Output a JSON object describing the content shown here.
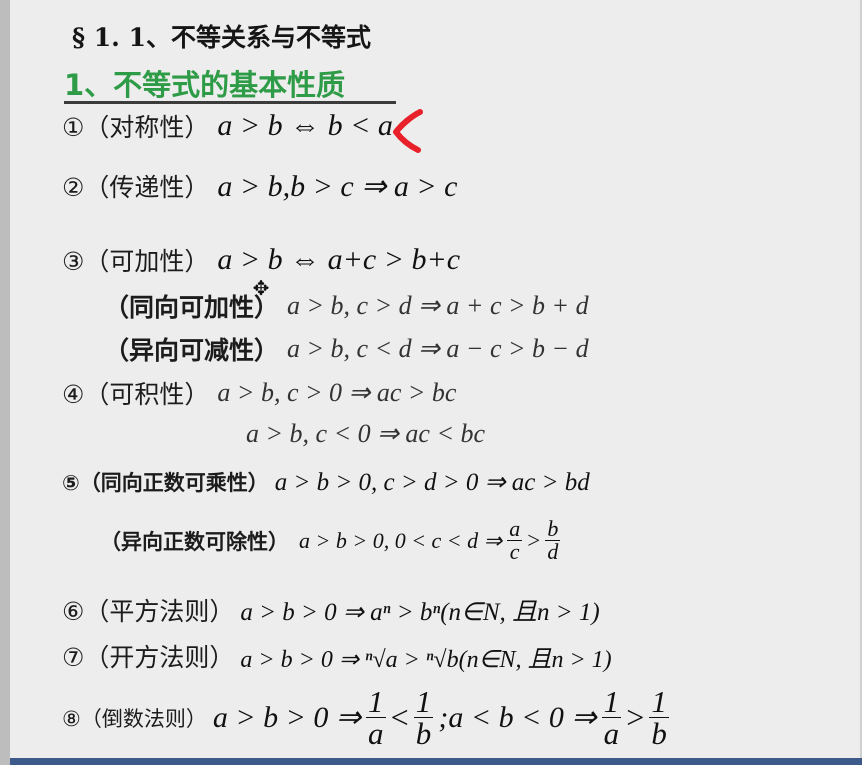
{
  "heading": "§ 1. 1、不等关系与不等式",
  "subheading": "1、不等式的基本性质",
  "accent_color": "#2e9b47",
  "properties": [
    {
      "label": "①（对称性）",
      "formula": "a > b ⇔ b < a"
    },
    {
      "label": "②（传递性）",
      "formula": "a > b,b > c ⇒ a > c"
    },
    {
      "label": "③（可加性）",
      "formula": "a > b ⇔ a+c > b+c"
    },
    {
      "label": "（同向可加性）",
      "formula": "a > b, c > d ⇒ a + c > b + d"
    },
    {
      "label": "（异向可减性）",
      "formula": "a > b, c < d ⇒ a − c > b − d"
    },
    {
      "label": "④（可积性）",
      "formula": "a > b, c > 0 ⇒ ac > bc"
    },
    {
      "label": "",
      "formula": "a > b, c < 0 ⇒ ac < bc"
    },
    {
      "label": "⑤（同向正数可乘性）",
      "formula": "a > b > 0, c > d > 0 ⇒ ac > bd"
    },
    {
      "label": "（异向正数可除性）",
      "formula_prefix": "a > b > 0, 0 < c < d ⇒",
      "frac1": {
        "num": "a",
        "den": "c"
      },
      "op": ">",
      "frac2": {
        "num": "b",
        "den": "d"
      }
    },
    {
      "label": "⑥（平方法则）",
      "formula": "a > b > 0 ⇒ aⁿ > bⁿ(n∈N, 且n > 1)"
    },
    {
      "label": "⑦（开方法则）",
      "formula": "a > b > 0 ⇒ ⁿ√a > ⁿ√b(n∈N, 且n > 1)"
    },
    {
      "label": "⑧（倒数法则）",
      "formula_prefix": "a > b > 0 ⇒",
      "frac1": {
        "num": "1",
        "den": "a"
      },
      "op": "<",
      "frac2": {
        "num": "1",
        "den": "b"
      },
      "mid": ";a < b < 0 ⇒",
      "frac3": {
        "num": "1",
        "den": "a"
      },
      "op2": ">",
      "frac4": {
        "num": "1",
        "den": "b"
      }
    }
  ],
  "annotation": {
    "icon": "pen-mark-icon",
    "color": "#e8202a"
  },
  "cursor": {
    "icon": "move-cursor-icon",
    "glyph": "✥"
  }
}
